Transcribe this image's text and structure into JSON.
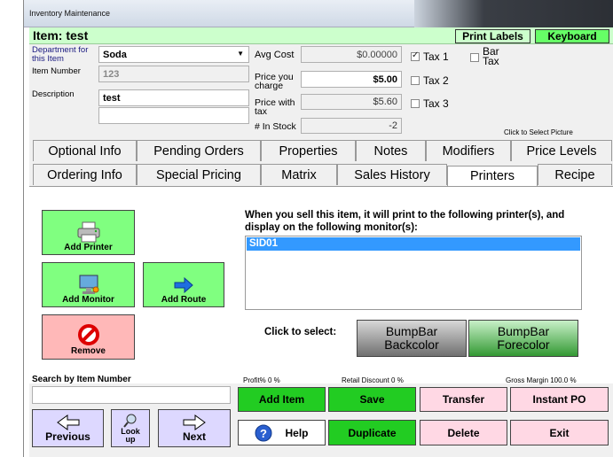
{
  "window": {
    "title": "Inventory Maintenance"
  },
  "header": {
    "item_prefix": "Item:",
    "item_name": "test",
    "print_labels": "Print Labels",
    "keyboard": "Keyboard"
  },
  "form": {
    "department_label": "Department for this Item",
    "department_value": "Soda",
    "item_number_label": "Item Number",
    "item_number_value": "123",
    "description_label": "Description",
    "description_value": "test",
    "description_line2": "",
    "avg_cost_label": "Avg Cost",
    "avg_cost_value": "$0.00000",
    "price_charge_label": "Price you charge",
    "price_charge_value": "$5.00",
    "price_tax_label": "Price with tax",
    "price_tax_value": "$5.60",
    "in_stock_label": "# In Stock",
    "in_stock_value": "-2",
    "tax1_label": "Tax 1",
    "tax1_checked": true,
    "tax2_label": "Tax 2",
    "tax3_label": "Tax 3",
    "bar_tax_label": "Bar Tax",
    "picture_hint": "Click to Select Picture"
  },
  "tabs_row1": [
    "Optional Info",
    "Pending Orders",
    "Properties",
    "Notes",
    "Modifiers",
    "Price Levels"
  ],
  "tabs_row2": [
    "Ordering Info",
    "Special Pricing",
    "Matrix",
    "Sales History",
    "Printers",
    "Recipe"
  ],
  "active_tab": "Printers",
  "printers": {
    "add_printer": "Add Printer",
    "add_monitor": "Add Monitor",
    "add_route": "Add Route",
    "remove": "Remove",
    "info": "When you sell this item, it will print to the following printer(s), and display on the following monitor(s):",
    "list": [
      "SID01"
    ],
    "click_to_select": "Click to select:",
    "bumpbar_back": [
      "BumpBar",
      "Backcolor"
    ],
    "bumpbar_fore": [
      "BumpBar",
      "Forecolor"
    ]
  },
  "footer": {
    "search_label": "Search by Item Number",
    "search_value": "",
    "profit": "Profit% 0 %",
    "retail_discount": "Retail Discount 0 %",
    "gross_margin": "Gross Margin 100.0 %",
    "previous": "Previous",
    "lookup": [
      "Look",
      "up"
    ],
    "next": "Next",
    "add_item": "Add Item",
    "save": "Save",
    "transfer": "Transfer",
    "instant_po": "Instant PO",
    "help": "Help",
    "duplicate": "Duplicate",
    "delete": "Delete",
    "exit": "Exit"
  }
}
